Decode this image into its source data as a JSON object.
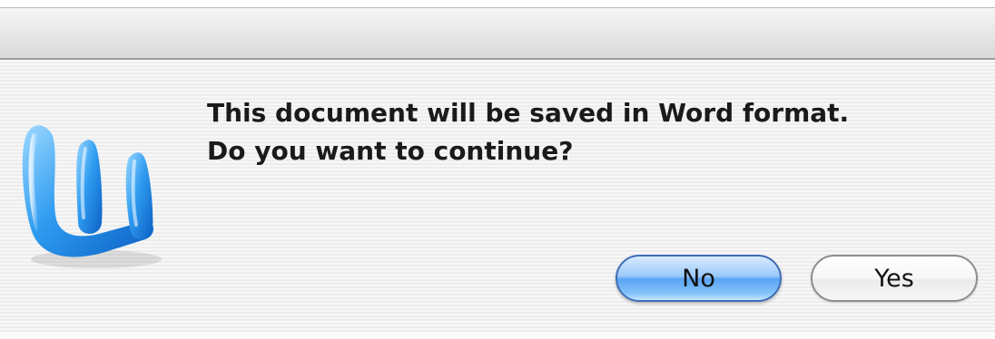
{
  "dialog": {
    "icon": "microsoft-word-app-icon",
    "message_line1": "This document will be saved in Word format.",
    "message_line2": "Do you want to continue?"
  },
  "buttons": {
    "no_label": "No",
    "yes_label": "Yes"
  },
  "colors": {
    "default_button": "#5aa4f3",
    "icon_blue": "#1a8ae6",
    "text": "#1a1a1a"
  }
}
